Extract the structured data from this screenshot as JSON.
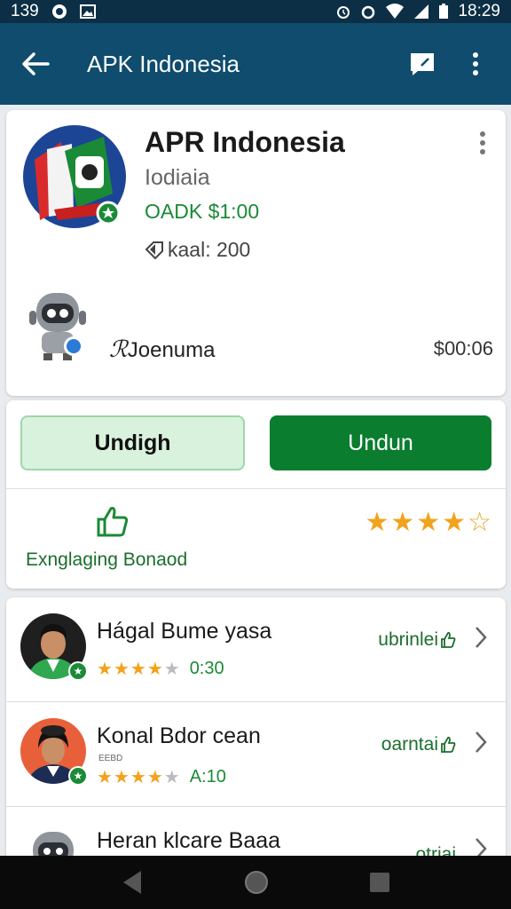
{
  "status_bar": {
    "time_left": "139",
    "time_right": "18:29"
  },
  "app_bar": {
    "title": "APK Indonesia"
  },
  "header": {
    "app_title": "APR Indonesia",
    "subtitle": "Iodiaia",
    "price": "OADK $1:00",
    "meta": "kaal: 200",
    "developer_name": "Joenuma",
    "developer_price": "$00:06"
  },
  "actions": {
    "secondary_label": "Undigh",
    "primary_label": "Undun",
    "like_label": "Exnglaging Bonaod",
    "rating_stars": 4,
    "rating_max": 5,
    "colors": {
      "primary": "#0a7d2f",
      "secondary_bg": "#d9f2dd",
      "star": "#f2a21b"
    }
  },
  "reviews": [
    {
      "name": "Hágal Bume yasa",
      "small": "",
      "stars": 4.5,
      "score": "0:30",
      "tag": "ubrinlei"
    },
    {
      "name": "Konal Bdor cean",
      "small": "EEBD",
      "stars": 4.5,
      "score": "A:10",
      "tag": "oarntai"
    },
    {
      "name": "Heran klcare Baaa",
      "small": "",
      "stars": 0,
      "score": "",
      "tag": "otriai"
    }
  ]
}
